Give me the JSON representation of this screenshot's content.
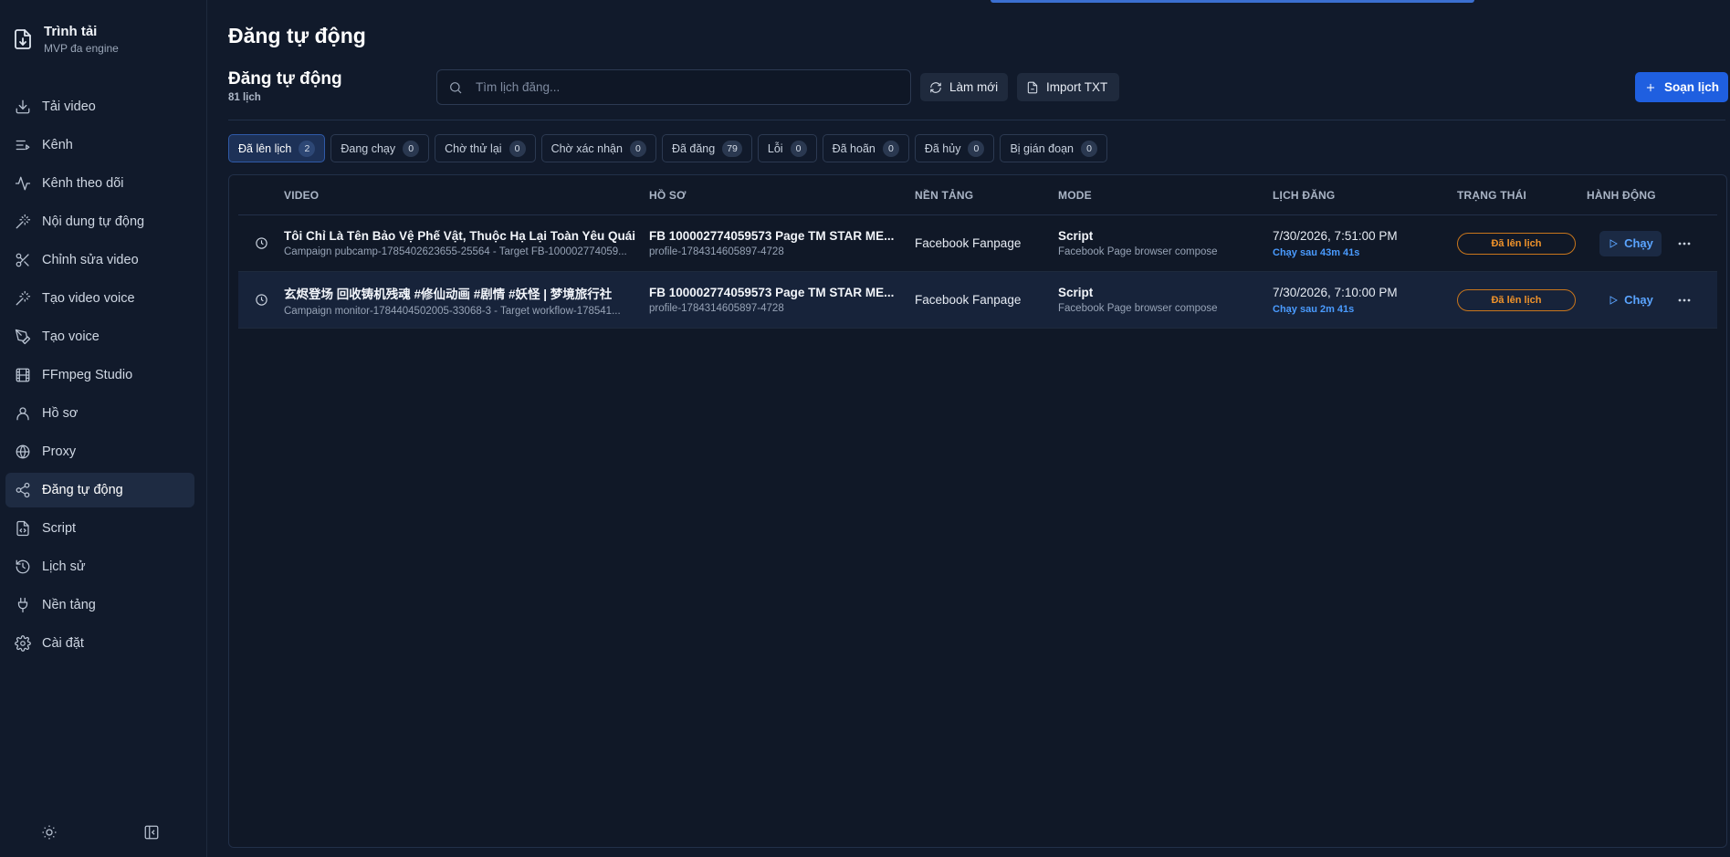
{
  "brand": {
    "title": "Trình tải",
    "subtitle": "MVP đa engine",
    "icon": "download-file-icon"
  },
  "sidebar": {
    "items": [
      {
        "label": "Tải video",
        "icon": "download-icon",
        "active": false
      },
      {
        "label": "Kênh",
        "icon": "list-icon",
        "active": false
      },
      {
        "label": "Kênh theo dõi",
        "icon": "activity-icon",
        "active": false
      },
      {
        "label": "Nội dung tự động",
        "icon": "magic-wand-icon",
        "active": false
      },
      {
        "label": "Chỉnh sửa video",
        "icon": "scissors-icon",
        "active": false
      },
      {
        "label": "Tạo video voice",
        "icon": "magic-wand-icon",
        "active": false
      },
      {
        "label": "Tạo voice",
        "icon": "pen-icon",
        "active": false
      },
      {
        "label": "FFmpeg Studio",
        "icon": "film-icon",
        "active": false
      },
      {
        "label": "Hồ sơ",
        "icon": "user-icon",
        "active": false
      },
      {
        "label": "Proxy",
        "icon": "globe-icon",
        "active": false
      },
      {
        "label": "Đăng tự động",
        "icon": "share-icon",
        "active": true
      },
      {
        "label": "Script",
        "icon": "code-file-icon",
        "active": false
      },
      {
        "label": "Lịch sử",
        "icon": "history-icon",
        "active": false
      },
      {
        "label": "Nền tảng",
        "icon": "plug-icon",
        "active": false
      },
      {
        "label": "Cài đặt",
        "icon": "gear-icon",
        "active": false
      }
    ],
    "bottom": {
      "theme_icon": "sun-icon",
      "collapse_icon": "sidebar-collapse-icon"
    }
  },
  "header": {
    "page_title": "Đăng tự động"
  },
  "section": {
    "title": "Đăng tự động",
    "count_label": "81 lịch"
  },
  "search": {
    "placeholder": "Tìm lịch đăng..."
  },
  "toolbar": {
    "refresh_label": "Làm mới",
    "import_label": "Import TXT",
    "compose_label": "Soạn lịch"
  },
  "tabs": [
    {
      "label": "Đã lên lịch",
      "count": "2",
      "active": true
    },
    {
      "label": "Đang chạy",
      "count": "0",
      "active": false
    },
    {
      "label": "Chờ thử lại",
      "count": "0",
      "active": false
    },
    {
      "label": "Chờ xác nhận",
      "count": "0",
      "active": false
    },
    {
      "label": "Đã đăng",
      "count": "79",
      "active": false
    },
    {
      "label": "Lỗi",
      "count": "0",
      "active": false
    },
    {
      "label": "Đã hoãn",
      "count": "0",
      "active": false
    },
    {
      "label": "Đã hủy",
      "count": "0",
      "active": false
    },
    {
      "label": "Bị gián đoạn",
      "count": "0",
      "active": false
    }
  ],
  "table": {
    "columns": [
      "VIDEO",
      "HỒ SƠ",
      "NỀN TẢNG",
      "MODE",
      "LỊCH ĐĂNG",
      "TRẠNG THÁI",
      "HÀNH ĐỘNG"
    ],
    "rows": [
      {
        "video_title": "Tôi Chỉ Là Tên Bảo Vệ Phế Vật, Thuộc Hạ Lại Toàn Yêu Quái",
        "video_sub": "Campaign pubcamp-1785402623655-25564 - Target FB-100002774059...",
        "profile": "FB 100002774059573 Page TM STAR ME...",
        "profile_sub": "profile-1784314605897-4728",
        "platform": "Facebook Fanpage",
        "mode": "Script",
        "mode_sub": "Facebook Page browser compose",
        "time": "7/30/2026, 7:51:00 PM",
        "countdown": "Chạy sau 43m 41s",
        "status": "Đã lên lịch",
        "action": "Chạy"
      },
      {
        "video_title": "玄烬登场 回收铸机残魂 #修仙动画 #剧情 #妖怪 | 梦境旅行社",
        "video_sub": "Campaign monitor-1784404502005-33068-3 - Target workflow-178541...",
        "profile": "FB 100002774059573 Page TM STAR ME...",
        "profile_sub": "profile-1784314605897-4728",
        "platform": "Facebook Fanpage",
        "mode": "Script",
        "mode_sub": "Facebook Page browser compose",
        "time": "7/30/2026, 7:10:00 PM",
        "countdown": "Chạy sau 2m 41s",
        "status": "Đã lên lịch",
        "action": "Chạy"
      }
    ]
  },
  "colors": {
    "accent": "#1f5fe0",
    "status_scheduled": "#f0932b",
    "countdown": "#4a9bff",
    "background": "#111a2b"
  }
}
